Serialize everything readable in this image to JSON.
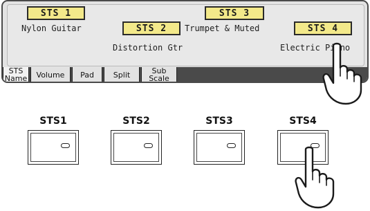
{
  "display": {
    "sts_buttons": [
      "STS 1",
      "STS 2",
      "STS 3",
      "STS 4"
    ],
    "sound_names": [
      "Nylon Guitar",
      "Distortion Gtr",
      "Trumpet & Muted",
      "Electric Piano"
    ],
    "selected_button_index": 3,
    "tabs": [
      {
        "label_line1": "STS",
        "label_line2": "Name",
        "active": true
      },
      {
        "label": "Volume"
      },
      {
        "label": "Pad"
      },
      {
        "label": "Split"
      },
      {
        "label_line1": "Sub",
        "label_line2": "Scale"
      }
    ]
  },
  "panel": {
    "buttons": [
      "STS1",
      "STS2",
      "STS3",
      "STS4"
    ]
  },
  "colors": {
    "button_fill": "#f3e98a",
    "display_bg": "#e3e3e3",
    "tab_bar": "#4a4a4a"
  },
  "icons": [
    "finger-pointer-icon",
    "finger-pointer-icon"
  ]
}
